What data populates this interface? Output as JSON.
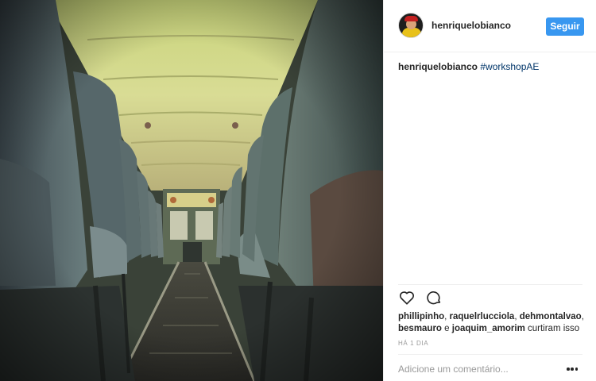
{
  "post": {
    "photo_alt": "",
    "author": {
      "username": "henriquelobianco",
      "follow_label": "Seguir"
    },
    "caption": {
      "author": "henriquelobianco",
      "hashtag": "#workshopAE"
    },
    "likes": {
      "names": [
        "phillipinho",
        "raquelrlucciola",
        "dehmontalvao",
        "besmauro",
        "joaquim_amorim"
      ],
      "separator_1": ", ",
      "separator_2": ", ",
      "separator_3": ",",
      "separator_4": " e ",
      "suffix": " curtiram isso"
    },
    "timestamp": "HÁ 1 DIA",
    "comment": {
      "placeholder": "Adicione um comentário..."
    },
    "icons": {
      "like": "heart-icon",
      "comment": "comment-bubble-icon",
      "options": "more-options-icon"
    },
    "colors": {
      "follow_button": "#3897f0",
      "hashtag": "#003569",
      "meta": "#999999"
    }
  }
}
